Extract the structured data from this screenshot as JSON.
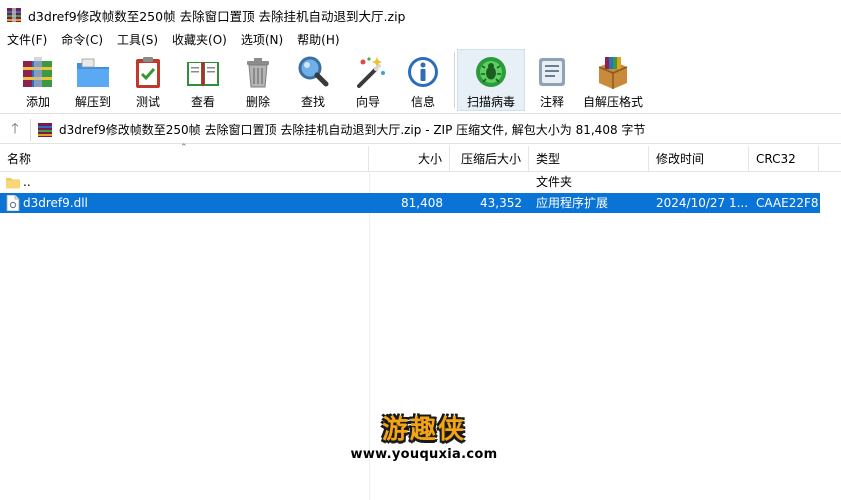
{
  "window": {
    "title": "d3dref9修改帧数至250帧 去除窗口置顶 去除挂机自动退到大厅.zip",
    "icon": "winrar-archive-icon"
  },
  "menu": [
    "文件(F)",
    "命令(C)",
    "工具(S)",
    "收藏夹(O)",
    "选项(N)",
    "帮助(H)"
  ],
  "toolbar": {
    "add": "添加",
    "extract": "解压到",
    "test": "测试",
    "view": "查看",
    "delete": "删除",
    "find": "查找",
    "wizard": "向导",
    "info": "信息",
    "virus_scan": "扫描病毒",
    "comment": "注释",
    "sfx": "自解压格式"
  },
  "address": {
    "text": "d3dref9修改帧数至250帧 去除窗口置顶 去除挂机自动退到大厅.zip - ZIP 压缩文件, 解包大小为 81,408 字节"
  },
  "columns": {
    "name": "名称",
    "size": "大小",
    "packed": "压缩后大小",
    "type": "类型",
    "modified": "修改时间",
    "crc": "CRC32"
  },
  "rows": [
    {
      "name": "..",
      "size": "",
      "packed": "",
      "type": "文件夹",
      "modified": "",
      "crc": ""
    },
    {
      "name": "d3dref9.dll",
      "size": "81,408",
      "packed": "43,352",
      "type": "应用程序扩展",
      "modified": "2024/10/27 1...",
      "crc": "CAAE22F8"
    }
  ],
  "watermark": {
    "title": "游趣侠",
    "url": "www.youquxia.com"
  },
  "colors": {
    "selection": "#0a74d6",
    "scan_highlight": "#e7f0f7"
  }
}
